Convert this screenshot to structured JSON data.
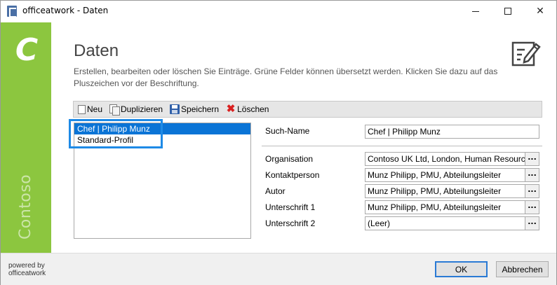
{
  "window": {
    "title": "officeatwork - Daten"
  },
  "sidebar": {
    "brand": "Contoso"
  },
  "header": {
    "title": "Daten",
    "description": "Erstellen, bearbeiten oder löschen Sie Einträge. Grüne Felder können übersetzt werden. Klicken Sie dazu auf das Pluszeichen vor der Beschriftung."
  },
  "toolbar": {
    "new_label": "Neu",
    "duplicate_label": "Duplizieren",
    "save_label": "Speichern",
    "delete_label": "Löschen"
  },
  "list": {
    "items": [
      {
        "label": "Chef | Philipp Munz",
        "selected": true
      },
      {
        "label": "Standard-Profil",
        "selected": false
      }
    ]
  },
  "form": {
    "search_name": {
      "label": "Such-Name",
      "value": "Chef | Philipp Munz"
    },
    "organisation": {
      "label": "Organisation",
      "value": "Contoso UK Ltd, London, Human Resources"
    },
    "contact": {
      "label": "Kontaktperson",
      "value": "Munz Philipp, PMU, Abteilungsleiter"
    },
    "author": {
      "label": "Autor",
      "value": "Munz Philipp, PMU, Abteilungsleiter"
    },
    "signature1": {
      "label": "Unterschrift 1",
      "value": "Munz Philipp, PMU, Abteilungsleiter"
    },
    "signature2": {
      "label": "Unterschrift 2",
      "value": "(Leer)"
    },
    "ellipsis": "..."
  },
  "footer": {
    "powered_line1": "powered by",
    "powered_line2": "officeatwork",
    "ok_label": "OK",
    "cancel_label": "Abbrechen"
  },
  "colors": {
    "accent_green": "#8cc63f",
    "selection_blue": "#0a74d6",
    "highlight_blue": "#1e8ae6"
  },
  "icons": [
    "app-icon",
    "minimize-icon",
    "maximize-icon",
    "close-icon",
    "edit-document-icon",
    "new-document-icon",
    "duplicate-icon",
    "save-icon",
    "delete-icon"
  ]
}
